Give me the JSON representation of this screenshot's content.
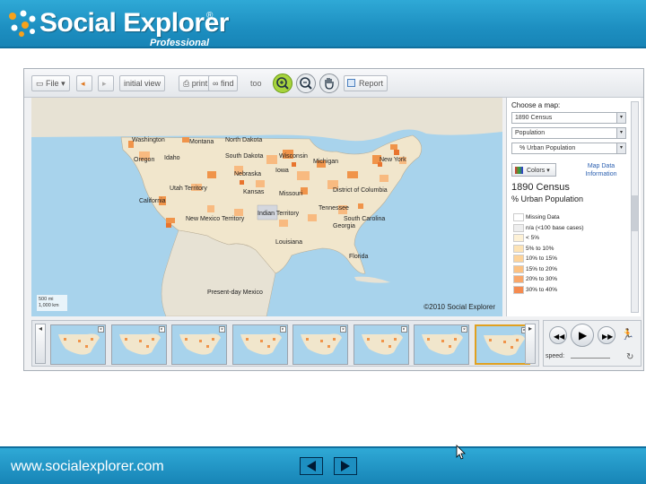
{
  "header": {
    "logo_text": "Social Explorer",
    "logo_reg": "®",
    "logo_sub": "Professional"
  },
  "toolbar": {
    "file_label": "File",
    "initial_view_label": "initial view",
    "print_label": "print",
    "find_label": "find",
    "tool_label": "too",
    "report_label": "Report"
  },
  "map": {
    "labels": [
      "Washington",
      "Montana",
      "North Dakota",
      "Oregon",
      "Idaho",
      "South Dakota",
      "Wisconsin",
      "Michigan",
      "New York",
      "Nebraska",
      "Iowa",
      "Utah Territory",
      "Kansas",
      "Missouri",
      "District of Columbia",
      "California",
      "Tennessee",
      "New Mexico Territory",
      "Georgia",
      "Louisiana",
      "Florida",
      "Present-day Mexico",
      "Indian Territory",
      "South Carolina"
    ],
    "copyright": "©2010 Social Explorer",
    "scale_mi": "500 mi",
    "scale_km": "1,000 km"
  },
  "panel": {
    "title": "Choose a map:",
    "select_year": "1890 Census",
    "select_topic": "Population",
    "select_variable": "% Urban Population",
    "colors_label": "Colors",
    "map_info": "Map Data Information",
    "legend_title": "1890 Census",
    "legend_subtitle": "% Urban Population",
    "legend_items": [
      {
        "label": "Missing Data",
        "color": "#ffffff"
      },
      {
        "label": "n/a (<100 base cases)",
        "color": "#eeeeee"
      },
      {
        "label": "< 5%",
        "color": "#fdf1d6"
      },
      {
        "label": "5% to 10%",
        "color": "#fde3b5"
      },
      {
        "label": "10% to 15%",
        "color": "#fdd39a"
      },
      {
        "label": "15% to 20%",
        "color": "#fcc182"
      },
      {
        "label": "20% to 30%",
        "color": "#f9a76a"
      },
      {
        "label": "30% to 40%",
        "color": "#f58b50"
      }
    ]
  },
  "player": {
    "speed_label": "speed:"
  },
  "footer": {
    "url": "www.socialexplorer.com"
  },
  "colors": {
    "header_blue": "#1d8fc1",
    "water": "#a8d3ec",
    "land": "#e7e2d4",
    "urban_low": "#fde3b5",
    "urban_high": "#e8742e"
  }
}
